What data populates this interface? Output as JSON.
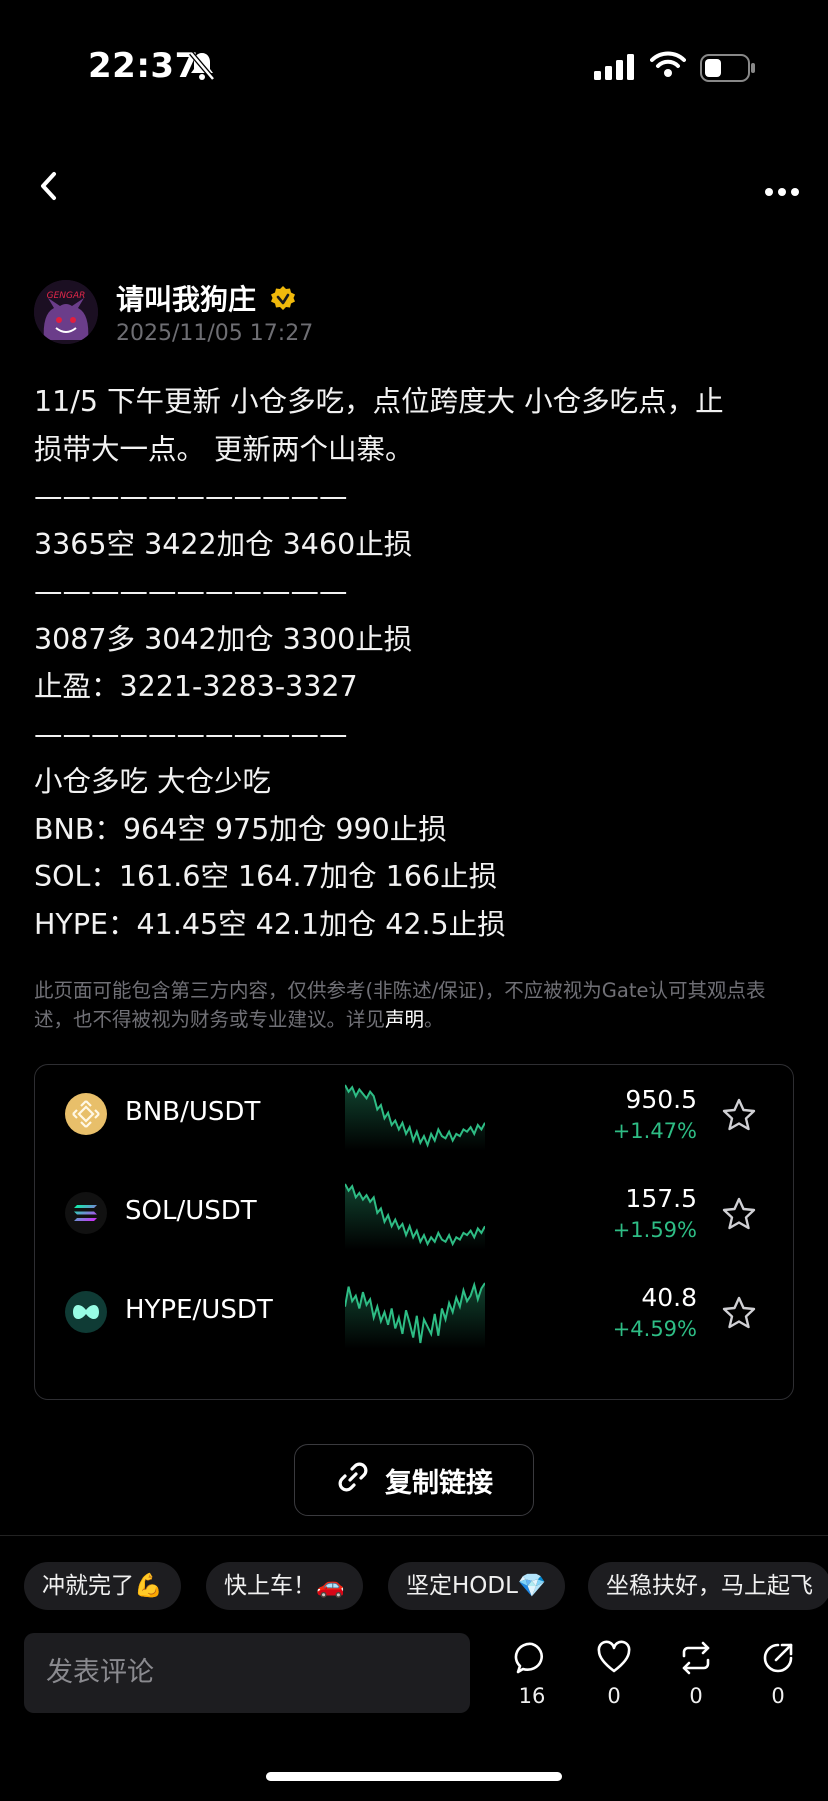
{
  "status_bar": {
    "time": "22:37"
  },
  "author": {
    "name": "请叫我狗庄",
    "avatar_text": "GENGAR",
    "date": "2025/11/05 17:27"
  },
  "post": {
    "lines": [
      "11/5 下午更新 小仓多吃，点位跨度大 小仓多吃点，止",
      "损带大一点。 更新两个山寨。",
      "———————————",
      "3365空 3422加仓 3460止损",
      "———————————",
      "3087多 3042加仓  3300止损",
      "止盈：3221-3283-3327",
      "———————————",
      "小仓多吃  大仓少吃",
      "BNB：964空  975加仓 990止损",
      "SOL：161.6空 164.7加仓 166止损",
      "HYPE：41.45空  42.1加仓 42.5止损"
    ]
  },
  "disclaimer": {
    "text": "此页面可能包含第三方内容，仅供参考(非陈述/保证)，不应被视为Gate认可其观点表述，也不得被视为财务或专业建议。详见",
    "link": "声明",
    "end": "。"
  },
  "tickers": [
    {
      "pair": "BNB/USDT",
      "price": "950.5",
      "change": "+1.47%",
      "icon": "bnb-coin-icon",
      "color": "#f3ba2f",
      "spark": [
        80,
        74,
        78,
        70,
        76,
        72,
        68,
        74,
        70,
        58,
        62,
        50,
        55,
        44,
        48,
        40,
        46,
        36,
        42,
        30,
        38,
        28,
        34,
        26,
        36,
        30,
        40,
        34,
        32,
        38,
        30,
        36,
        34,
        40,
        38,
        42,
        36,
        44,
        40,
        46
      ]
    },
    {
      "pair": "SOL/USDT",
      "price": "157.5",
      "change": "+1.59%",
      "icon": "sol-coin-icon",
      "color": "#9945ff",
      "spark": [
        82,
        76,
        80,
        70,
        74,
        68,
        72,
        66,
        70,
        56,
        60,
        48,
        54,
        44,
        50,
        42,
        46,
        36,
        44,
        34,
        40,
        30,
        36,
        28,
        34,
        30,
        38,
        32,
        30,
        36,
        28,
        34,
        32,
        38,
        36,
        40,
        34,
        42,
        38,
        44
      ]
    },
    {
      "pair": "HYPE/USDT",
      "price": "40.8",
      "change": "+4.59%",
      "icon": "hype-coin-icon",
      "color": "#50d2c1",
      "spark": [
        60,
        82,
        66,
        72,
        58,
        76,
        62,
        68,
        48,
        60,
        44,
        54,
        40,
        58,
        36,
        48,
        30,
        56,
        42,
        26,
        50,
        20,
        46,
        38,
        30,
        52,
        28,
        58,
        46,
        64,
        54,
        70,
        60,
        78,
        66,
        72,
        84,
        68,
        80,
        86
      ]
    }
  ],
  "copy_link_label": "复制链接",
  "quick_replies": [
    "冲就完了💪",
    "快上车！🚗",
    "坚定HODL💎",
    "坐稳扶好，马上起飞"
  ],
  "comment": {
    "placeholder": "发表评论"
  },
  "actions": [
    {
      "name": "comment",
      "count": "16"
    },
    {
      "name": "like",
      "count": "0"
    },
    {
      "name": "repost",
      "count": "0"
    },
    {
      "name": "share",
      "count": "0"
    }
  ],
  "colors": {
    "up": "#2ebd85",
    "accent_gold": "#f0b90b",
    "background": "#000000"
  }
}
